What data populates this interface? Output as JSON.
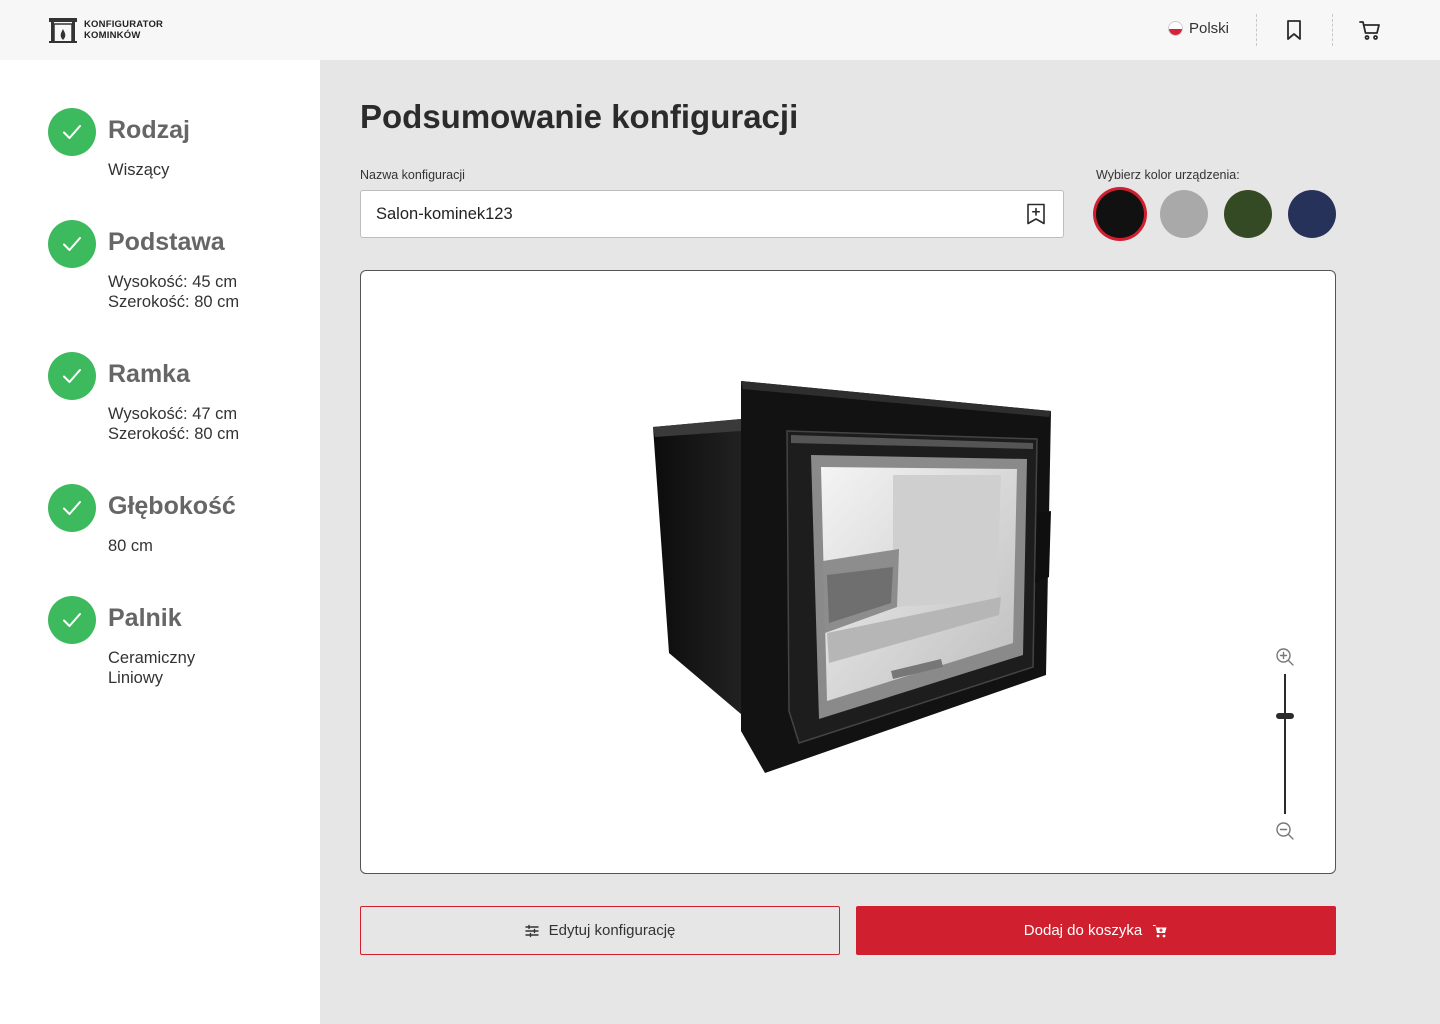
{
  "header": {
    "logo_line1": "KONFIGURATOR",
    "logo_line2": "KOMINKÓW",
    "language": "Polski",
    "icons": [
      "fireplace-logo-icon",
      "poland-flag-icon",
      "bookmark-icon",
      "cart-icon"
    ]
  },
  "steps": [
    {
      "title": "Rodzaj",
      "values": [
        "Wiszący"
      ]
    },
    {
      "title": "Podstawa",
      "values": [
        "Wysokość: 45 cm",
        "Szerokość: 80 cm"
      ]
    },
    {
      "title": "Ramka",
      "values": [
        "Wysokość: 47 cm",
        "Szerokość: 80 cm"
      ]
    },
    {
      "title": "Głębokość",
      "values": [
        "80 cm"
      ]
    },
    {
      "title": "Palnik",
      "values": [
        "Ceramiczny",
        "Liniowy"
      ]
    }
  ],
  "main": {
    "title": "Podsumowanie konfiguracji",
    "name_label": "Nazwa konfiguracji",
    "name_value": "Salon-kominek123",
    "color_label": "Wybierz kolor urządzenia:",
    "colors": [
      {
        "name": "black",
        "hex": "#111111",
        "selected": true
      },
      {
        "name": "grey",
        "hex": "#a9a9a9",
        "selected": false
      },
      {
        "name": "green",
        "hex": "#344a24",
        "selected": false
      },
      {
        "name": "navy",
        "hex": "#263259",
        "selected": false
      }
    ],
    "zoom_level": 0.7,
    "edit_button": "Edytuj konfigurację",
    "cart_button": "Dodaj do koszyka"
  },
  "colors": {
    "accent": "#d01f2e",
    "success": "#3dba5e"
  }
}
